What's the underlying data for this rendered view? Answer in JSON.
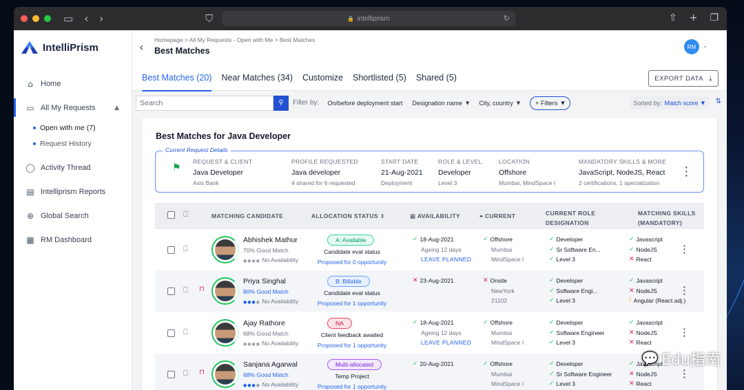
{
  "browser": {
    "url": "intelliprism",
    "lock_icon": "lock-icon"
  },
  "app": {
    "brand": "IntelliPrism",
    "user_initials": "RM"
  },
  "sidebar": {
    "items": [
      {
        "label": "Home",
        "icon": "home-icon"
      },
      {
        "label": "All My Requests",
        "icon": "folder-icon"
      },
      {
        "label": "Activity Thread",
        "icon": "chat-icon"
      },
      {
        "label": "Intelliprism Reports",
        "icon": "report-icon"
      },
      {
        "label": "Global Search",
        "icon": "globe-search-icon"
      },
      {
        "label": "RM Dashboard",
        "icon": "dashboard-icon"
      }
    ],
    "sub_items": [
      {
        "label": "Open with me (7)"
      },
      {
        "label": "Request History"
      }
    ]
  },
  "header": {
    "breadcrumb": "Homepage > All My Requests - Open with Me > Best Matches",
    "title": "Best Matches"
  },
  "tabs": [
    {
      "label": "Best Matches (20)"
    },
    {
      "label": "Near Matches (34)"
    },
    {
      "label": "Customize"
    },
    {
      "label": "Shortlisted (5)"
    },
    {
      "label": "Shared (5)"
    }
  ],
  "export_label": "EXPORT DATA",
  "filters": {
    "search_placeholder": "Search",
    "filter_by": "Filter by:",
    "deployment": "On/before deployment start",
    "designation": "Designation name",
    "city": "City, country",
    "more": "+ Filters",
    "sorted_by_label": "Sorted by:",
    "sorted_by_value": "Match score"
  },
  "card": {
    "title": "Best Matches for Java Developer",
    "legend": "Current Request Details",
    "request": [
      {
        "h": "REQUEST & CLIENT",
        "v": "Java Developer",
        "s": "Axis Bank"
      },
      {
        "h": "PROFILE REQUESTED",
        "v": "Java developer",
        "s": "4 shared for 6 requested"
      },
      {
        "h": "START DATE",
        "v": "21-Aug-2021",
        "s": "Deployment"
      },
      {
        "h": "ROLE & LEVEL",
        "v": "Developer",
        "s": "Level 3"
      },
      {
        "h": "LOCATION",
        "v": "Offshore",
        "s": "Mumbai, MindSpace I"
      },
      {
        "h": "MANDATORY SKILLS & MORE",
        "v": "JavaScript, NodeJS, React",
        "s": "2 certifications, 1 specialization"
      }
    ]
  },
  "table": {
    "headers": {
      "candidate": "MATCHING CANDIDATE",
      "allocation": "ALLOCATION STATUS",
      "availability": "AVAILABILITY",
      "current": "CURRENT",
      "role_1": "CURRENT ROLE",
      "role_2": "DESIGNATION",
      "skills_1": "MATCHING SKILLS",
      "skills_2": "(MANDATORY)"
    },
    "rows": [
      {
        "name": "Abhishek Mathur",
        "match": "70% Good Match",
        "avail": "No Availability",
        "dots": 0,
        "locked": false,
        "status": "A: Available",
        "status_class": "st-avail",
        "status_sub": "Candidate eval status",
        "status_link": "Proposed for 0 opportunity",
        "date": "18-Aug-2021",
        "date_ok": true,
        "date_sub": "Ageing 12 days",
        "date_link": "LEAVE PLANNED",
        "loc": "Offshore",
        "loc_ok": true,
        "loc_1": "Mumbai",
        "loc_2": "MindSpace I",
        "role": [
          "Developer",
          "Sr Software En...",
          "Level 3"
        ],
        "role_ok": [
          true,
          true,
          true
        ],
        "skills": [
          "Javascript",
          "NodeJS",
          "React"
        ],
        "skills_st": [
          "ok",
          "ok",
          "bad"
        ]
      },
      {
        "name": "Priya Singhal",
        "match": "80% Good Match",
        "avail": "No Availability",
        "dots": 3,
        "locked": true,
        "status": "B: Billable",
        "status_class": "st-bill",
        "status_sub": "Candidate eval status",
        "status_link": "Proposed for 1 opportunity",
        "date": "23-Aug-2021",
        "date_ok": false,
        "date_sub": "",
        "date_link": "",
        "loc": "Onsite",
        "loc_ok": false,
        "loc_1": "NewYork",
        "loc_2": "21102",
        "role": [
          "Developer",
          "Software Engi...",
          "Level 3"
        ],
        "role_ok": [
          true,
          true,
          true
        ],
        "skills": [
          "Javascript",
          "NodeJS",
          "Angular (React adj.)"
        ],
        "skills_st": [
          "ok",
          "bad",
          "warn"
        ]
      },
      {
        "name": "Ajay Rathore",
        "match": "68% Good Match",
        "avail": "No Availability",
        "dots": 0,
        "locked": false,
        "status": "NA",
        "status_class": "st-na",
        "status_sub": "Client feedback awaited",
        "status_link": "Proposed for 1 opportunity",
        "date": "18-Aug-2021",
        "date_ok": true,
        "date_sub": "Ageing 12 days",
        "date_link": "LEAVE PLANNED",
        "loc": "Offshore",
        "loc_ok": true,
        "loc_1": "Mumbai",
        "loc_2": "MindSpace I",
        "role": [
          "Developer",
          "Software Engineer",
          "Level 3"
        ],
        "role_ok": [
          true,
          true,
          true
        ],
        "skills": [
          "Javascript",
          "NodeJS",
          "React"
        ],
        "skills_st": [
          "ok",
          "bad",
          "bad"
        ]
      },
      {
        "name": "Sanjana Agarwal",
        "match": "68% Good Match",
        "avail": "No Availability",
        "dots": 3,
        "locked": true,
        "status": "Multi-allocated",
        "status_class": "st-multi",
        "status_sub": "Temp Project",
        "status_link": "Proposed for 1 opportunity",
        "date": "20-Aug-2021",
        "date_ok": true,
        "date_sub": "",
        "date_link": "",
        "loc": "Offshore",
        "loc_ok": true,
        "loc_1": "Mumbai",
        "loc_2": "MindSpace I",
        "role": [
          "Developer",
          "Sr Software Engineer",
          "Level 3"
        ],
        "role_ok": [
          true,
          true,
          true
        ],
        "skills": [
          "Javascript",
          "NodeJS",
          "React"
        ],
        "skills_st": [
          "ok",
          "bad",
          "bad"
        ]
      }
    ]
  },
  "watermark": "Edu指南"
}
